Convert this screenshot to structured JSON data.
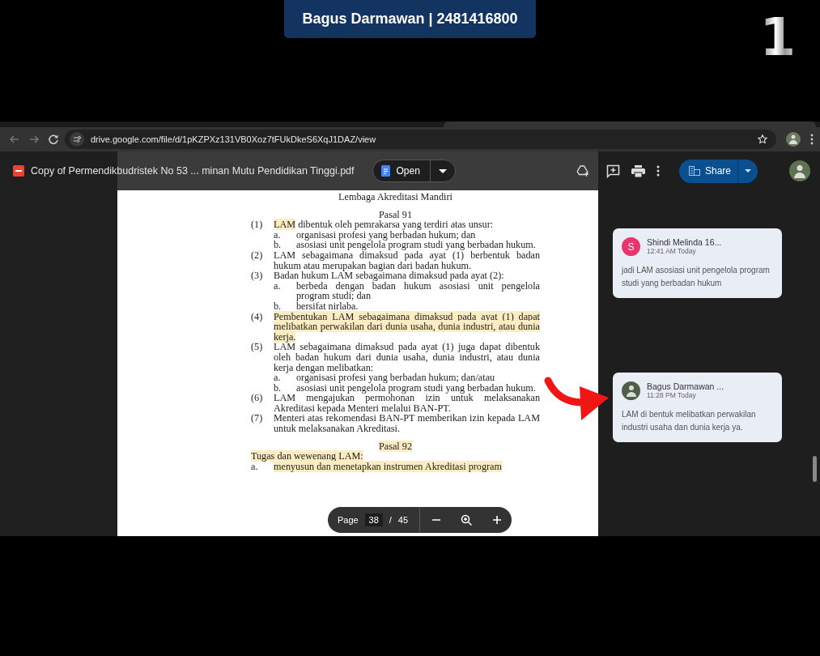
{
  "overlay": {
    "banner": "Bagus Darmawan | 2481416800",
    "step_number": "1"
  },
  "browser": {
    "url": "drive.google.com/file/d/1pKZPXz131VB0Xoz7tFUkDkeS6XqJ1DAZ/view"
  },
  "viewer": {
    "file_name": "Copy of Permendikbudristek No 53 ... minan Mutu Pendidikan Tinggi.pdf",
    "open_button": "Open",
    "share_button": "Share"
  },
  "document": {
    "heading": "Lembaga Akreditasi Mandiri",
    "articles": [
      {
        "title": "Pasal 91",
        "title_highlighted": false,
        "blocks": [
          {
            "kind": "clause",
            "number": "(1)",
            "segments": [
              {
                "text": "LAM",
                "highlighted": true
              },
              {
                "text": " dibentuk oleh pemrakarsa yang terdiri atas unsur:",
                "highlighted": false
              }
            ],
            "items": [
              {
                "letter": "a.",
                "segments": [
                  {
                    "text": "organisasi profesi yang berbadan hukum; dan",
                    "highlighted": false
                  }
                ]
              },
              {
                "letter": "b.",
                "segments": [
                  {
                    "text": "asosiasi unit pengelola program studi yang berbadan hukum.",
                    "highlighted": false
                  }
                ]
              }
            ]
          },
          {
            "kind": "clause",
            "number": "(2)",
            "segments": [
              {
                "text": "LAM sebagaimana dimaksud pada ayat (1) berbentuk badan hukum atau merupakan bagian dari badan hukum.",
                "highlighted": false
              }
            ]
          },
          {
            "kind": "clause",
            "number": "(3)",
            "segments": [
              {
                "text": "Badan hukum LAM sebagaimana dimaksud pada ayat (2):",
                "highlighted": false
              }
            ],
            "items": [
              {
                "letter": "a.",
                "segments": [
                  {
                    "text": "berbeda dengan badan hukum asosiasi unit pengelola program studi; dan",
                    "highlighted": false
                  }
                ]
              },
              {
                "letter": "b.",
                "segments": [
                  {
                    "text": "bersifat nirlaba.",
                    "highlighted": false
                  }
                ]
              }
            ]
          },
          {
            "kind": "clause",
            "number": "(4)",
            "segments": [
              {
                "text": "Pembentukan LAM sebagaimana dimaksud pada ayat (1) dapat melibatkan perwakilan dari dunia usaha, dunia industri, atau dunia kerja.",
                "highlighted": true
              }
            ]
          },
          {
            "kind": "clause",
            "number": "(5)",
            "segments": [
              {
                "text": "LAM sebagaimana dimaksud pada ayat (1) juga dapat dibentuk oleh badan hukum dari dunia usaha, dunia industri, atau dunia kerja dengan melibatkan:",
                "highlighted": false
              }
            ],
            "items": [
              {
                "letter": "a.",
                "segments": [
                  {
                    "text": "organisasi profesi yang berbadan hukum; dan/atau",
                    "highlighted": false
                  }
                ]
              },
              {
                "letter": "b.",
                "segments": [
                  {
                    "text": "asosiasi unit pengelola program studi yang berbadan hukum.",
                    "highlighted": false
                  }
                ]
              }
            ]
          },
          {
            "kind": "clause",
            "number": "(6)",
            "segments": [
              {
                "text": "LAM mengajukan permohonan izin untuk melaksanakan Akreditasi kepada Menteri melalui BAN-PT.",
                "highlighted": false
              }
            ]
          },
          {
            "kind": "clause",
            "number": "(7)",
            "segments": [
              {
                "text": "Menteri atas rekomendasi BAN-PT memberikan izin kepada LAM untuk melaksanakan Akreditasi.",
                "highlighted": false
              }
            ]
          }
        ]
      },
      {
        "title": "Pasal 92",
        "title_highlighted": true,
        "blocks": [
          {
            "kind": "intro",
            "segments": [
              {
                "text": "Tugas dan wewenang LAM:",
                "highlighted": true
              }
            ]
          },
          {
            "kind": "item",
            "letter": "a.",
            "segments": [
              {
                "text": "menyusun dan menetapkan instrumen Akreditasi program",
                "highlighted": true
              }
            ]
          }
        ]
      }
    ]
  },
  "page_nav": {
    "label": "Page",
    "current": "38",
    "separator": "/",
    "total": "45"
  },
  "comments": [
    {
      "author": "Shindi Melinda 16...",
      "time": "12:41 AM Today",
      "text": "jadi LAM asosiasi unit pengelola program studi yang berbadan hukum",
      "kind": "initial_avatar",
      "initial": "S"
    },
    {
      "author": "Bagus Darmawan ...",
      "time": "11:28 PM Today",
      "text": "LAM di bentuk melibatkan perwakilan industri usaha dan dunia kerja ya.",
      "kind": "photo_avatar"
    }
  ]
}
